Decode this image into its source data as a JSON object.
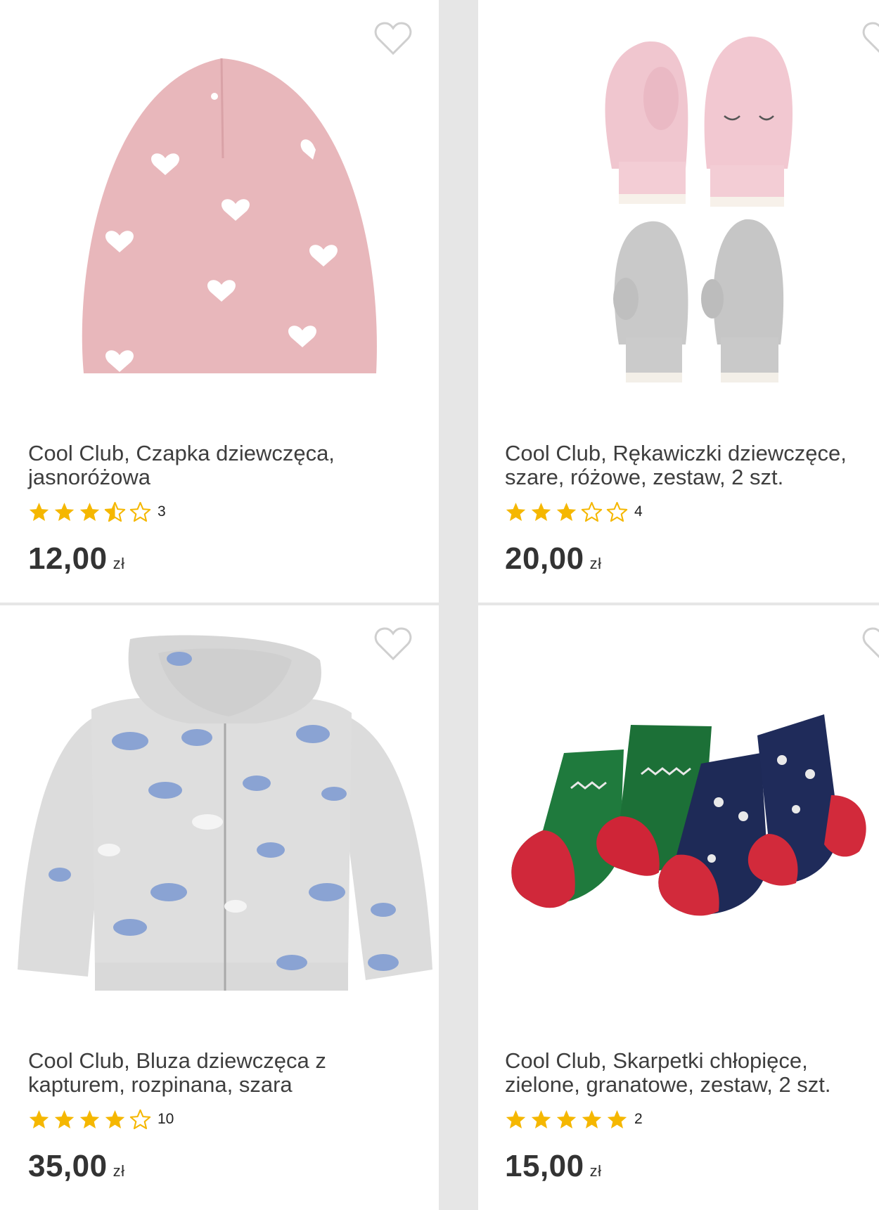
{
  "colors": {
    "star": "#f5b700",
    "star_empty": "#8a8a8a",
    "heart_outline": "#cfcfcf",
    "title_text": "#3e3e3e",
    "price_text": "#333333"
  },
  "products": [
    {
      "title": "Cool Club, Czapka dziewczęca, jasnoróżowa",
      "image_icon": "pink-heart-beanie-image",
      "rating": 3.5,
      "rating_count": "3",
      "price": "12,00",
      "currency": "zł"
    },
    {
      "title": "Cool Club, Rękawiczki dziewczęce, szare, różowe, zestaw, 2 szt.",
      "image_icon": "knit-mittens-image",
      "rating": 3,
      "rating_count": "4",
      "price": "20,00",
      "currency": "zł"
    },
    {
      "title": "Cool Club, Bluza dziewczęca z kapturem, rozpinana, szara",
      "image_icon": "grey-hoodie-image",
      "rating": 4,
      "rating_count": "10",
      "price": "35,00",
      "currency": "zł"
    },
    {
      "title": "Cool Club, Skarpetki chłopięce, zielone, granatowe, zestaw, 2 szt.",
      "image_icon": "christmas-socks-image",
      "rating": 5,
      "rating_count": "2",
      "price": "15,00",
      "currency": "zł"
    }
  ]
}
